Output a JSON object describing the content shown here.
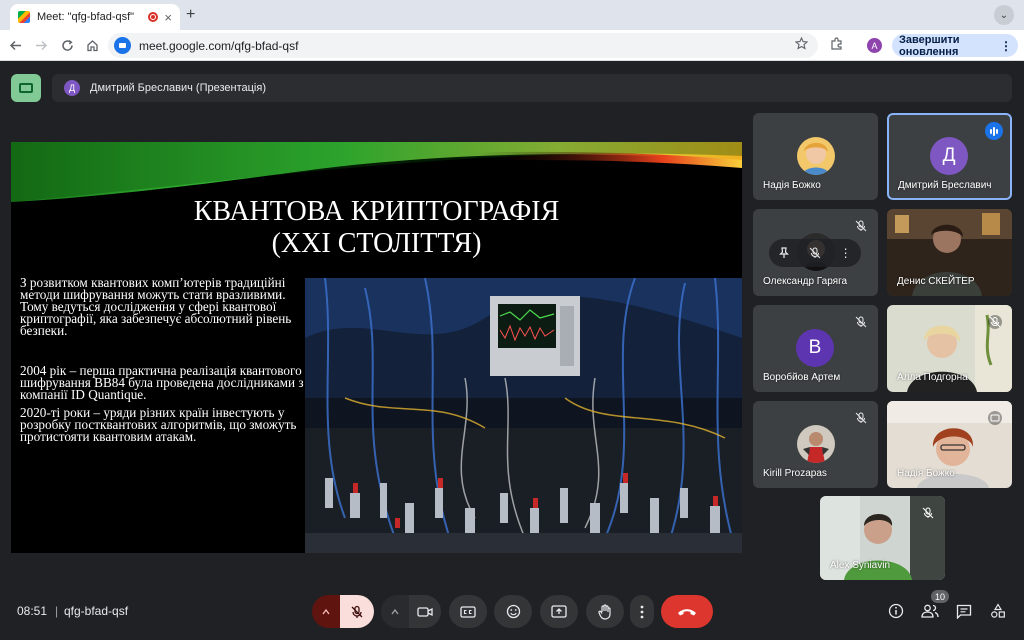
{
  "browser": {
    "tab_title": "Meet: \"qfg-bfad-qsf\"",
    "tab_close_icon": "×",
    "new_tab_label": "+",
    "tab_menu_icon": "⌄",
    "url": "meet.google.com/qfg-bfad-qsf",
    "profile_initial": "A",
    "update_button": "Завершити оновлення",
    "update_menu_icon": "⋮"
  },
  "meet": {
    "presenter_initial": "Д",
    "presenter_label": "Дмитрий Бреславич (Презентація)",
    "meeting_time": "08:51",
    "separator": "|",
    "meeting_code": "qfg-bfad-qsf",
    "participants_count": "10"
  },
  "slide": {
    "title_line1": "КВАНТОВА КРИПТОГРАФІЯ",
    "title_line2": "(XXI СТОЛІТТЯ)",
    "para1": "З розвитком квантових комп’ютерів традиційні методи шифрування можуть стати вразливими. Тому ведуться дослідження у сфері квантової криптографії, яка забезпечує абсолютний рівень безпеки.",
    "para2": "2004 рік – перша практична реалізація квантового шифрування BB84 була проведена дослідниками з компанії ID Quantique.",
    "para3": "2020-ті роки – уряди різних країн інвестують у розробку постквантових алгоритмів, що зможуть протистояти квантовим атакам."
  },
  "participants": [
    {
      "name": "Надія Божко",
      "avatar": "photo-avatar",
      "muted": false
    },
    {
      "name": "Дмитрий Бреславич",
      "avatar_letter": "Д",
      "avatar_color": "#7e57c2",
      "speaking": true
    },
    {
      "name": "Олександр Гаряга",
      "avatar": "photo-avatar",
      "muted": true
    },
    {
      "name": "Денис СКЕЙТЕР",
      "avatar": "video",
      "muted": false
    },
    {
      "name": "Воробйов Артем",
      "avatar_letter": "В",
      "avatar_color": "#5e35b1",
      "muted": true
    },
    {
      "name": "Алла Подгорна",
      "avatar": "video",
      "muted": true
    },
    {
      "name": "Kirill Prozapas",
      "avatar": "photo-avatar",
      "muted": true
    },
    {
      "name": "Надія Божко",
      "avatar": "video",
      "presenting_icon": true
    },
    {
      "name": "Alex Syniavin",
      "avatar": "video",
      "muted": true
    }
  ],
  "colors": {
    "meet_bg": "#202124",
    "tile_bg": "#3c4043",
    "leave_red": "#dc362e",
    "mic_off_bg": "#f9dedc",
    "active_border": "#8ab4f8"
  }
}
